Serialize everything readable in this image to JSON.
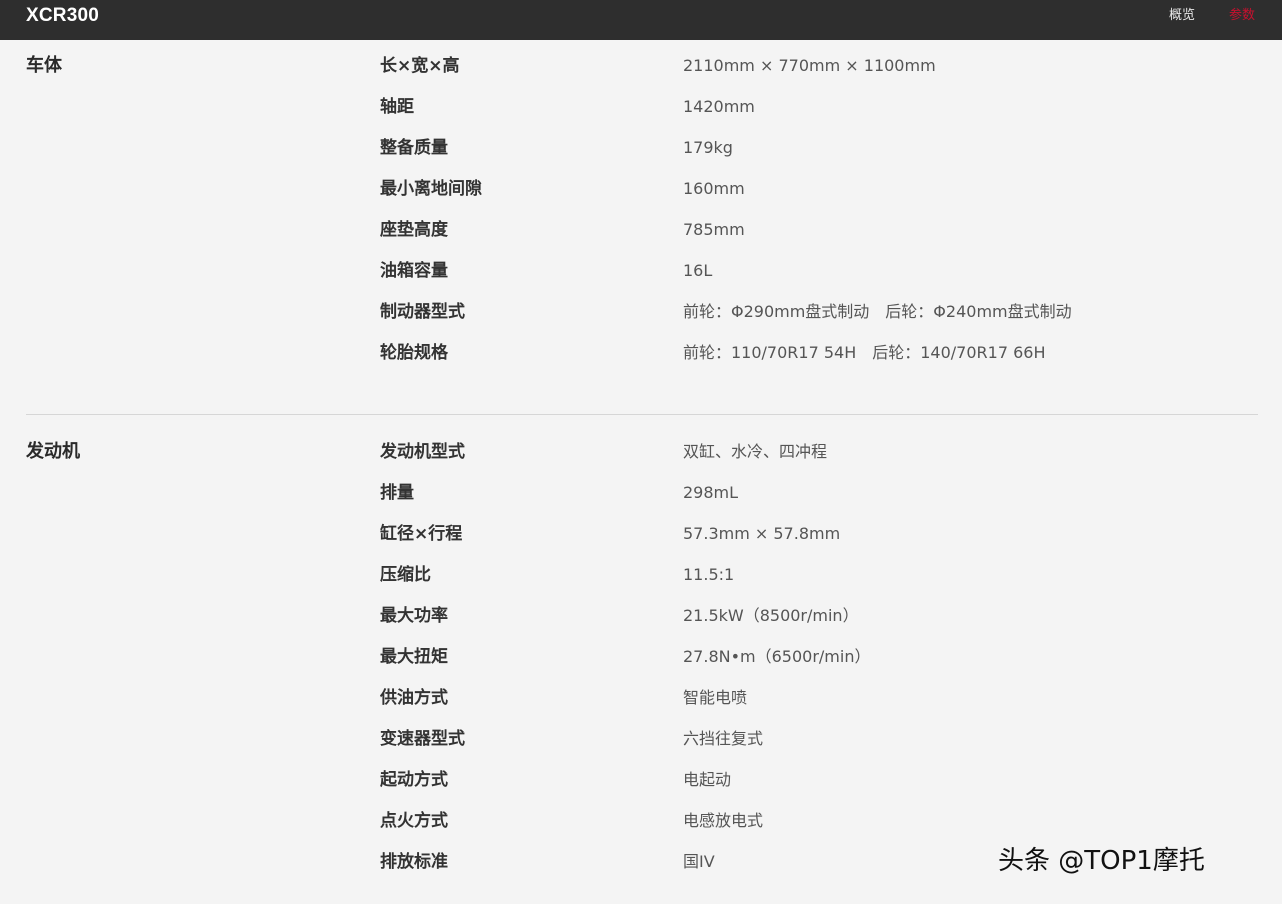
{
  "header": {
    "brand": "XCR300",
    "nav": {
      "overview": "概览",
      "spec": "参数"
    }
  },
  "sections": [
    {
      "title": "车体",
      "rows": [
        {
          "label": "长×宽×高",
          "value": "2110mm × 770mm × 1100mm"
        },
        {
          "label": "轴距",
          "value": "1420mm"
        },
        {
          "label": "整备质量",
          "value": "179kg"
        },
        {
          "label": "最小离地间隙",
          "value": "160mm"
        },
        {
          "label": "座垫高度",
          "value": "785mm"
        },
        {
          "label": "油箱容量",
          "value": "16L"
        },
        {
          "label": "制动器型式",
          "value": "前轮：Φ290mm盘式制动　后轮：Φ240mm盘式制动"
        },
        {
          "label": "轮胎规格",
          "value": "前轮：110/70R17 54H　后轮：140/70R17 66H"
        }
      ]
    },
    {
      "title": "发动机",
      "rows": [
        {
          "label": "发动机型式",
          "value": "双缸、水冷、四冲程"
        },
        {
          "label": "排量",
          "value": "298mL"
        },
        {
          "label": "缸径×行程",
          "value": "57.3mm × 57.8mm"
        },
        {
          "label": "压缩比",
          "value": "11.5:1"
        },
        {
          "label": "最大功率",
          "value": "21.5kW（8500r/min）"
        },
        {
          "label": "最大扭矩",
          "value": "27.8N•m（6500r/min）"
        },
        {
          "label": "供油方式",
          "value": "智能电喷"
        },
        {
          "label": "变速器型式",
          "value": "六挡往复式"
        },
        {
          "label": "起动方式",
          "value": "电起动"
        },
        {
          "label": "点火方式",
          "value": "电感放电式"
        },
        {
          "label": "排放标准",
          "value": "国IV"
        }
      ]
    }
  ],
  "watermark": "头条 @TOP1摩托",
  "colors": {
    "topbar": "#2e2e2e",
    "accent": "#c8102e",
    "background": "#f4f4f4"
  }
}
